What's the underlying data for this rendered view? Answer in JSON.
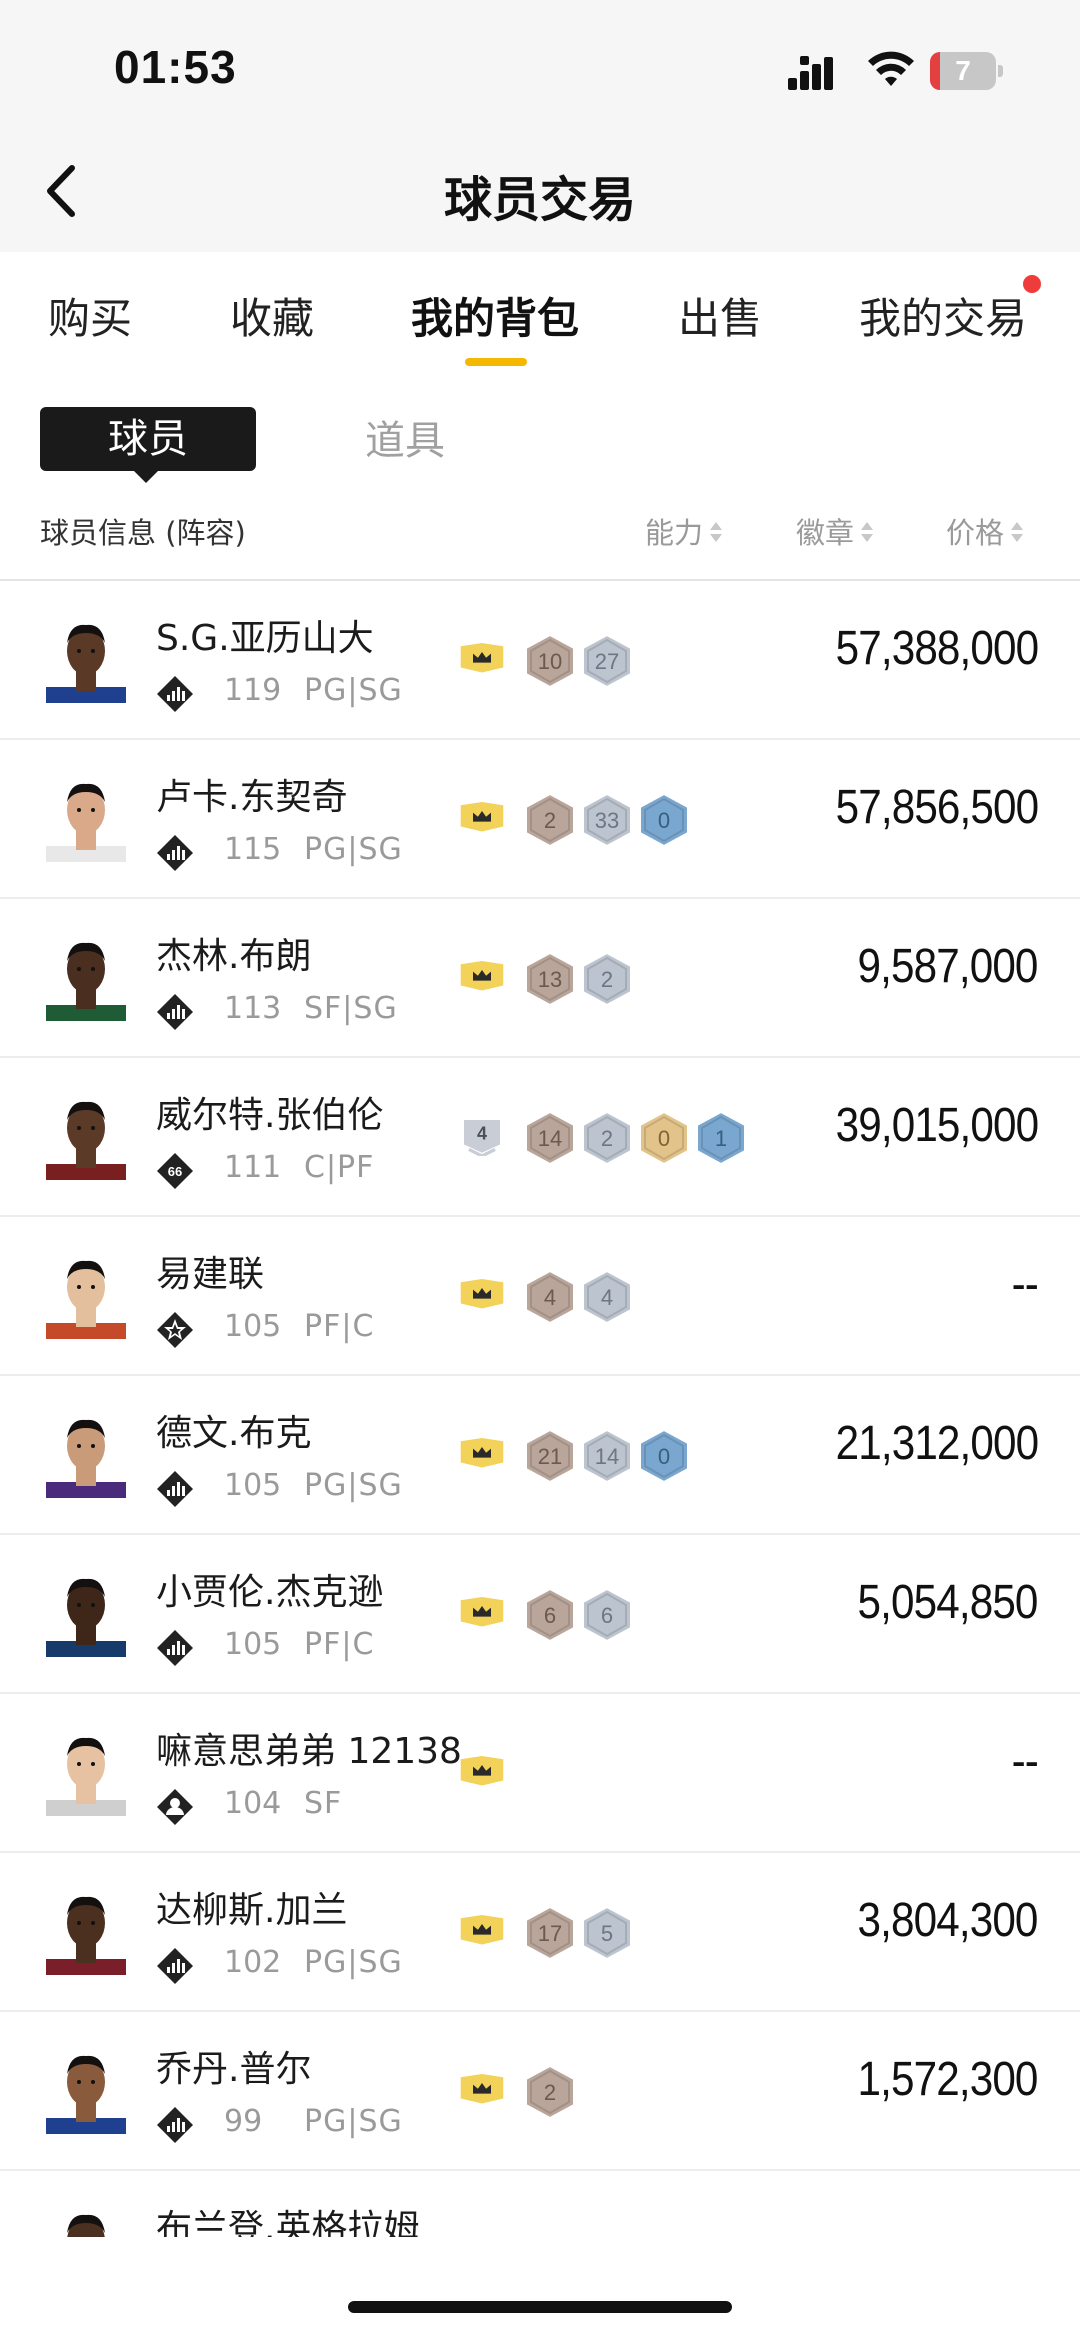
{
  "status": {
    "time": "01:53",
    "battery": "7"
  },
  "header": {
    "title": "球员交易"
  },
  "tabs": [
    {
      "label": "购买",
      "active": false
    },
    {
      "label": "收藏",
      "active": false
    },
    {
      "label": "我的背包",
      "active": true
    },
    {
      "label": "出售",
      "active": false
    },
    {
      "label": "我的交易",
      "active": false,
      "dot": true
    }
  ],
  "segment": {
    "active": "球员",
    "inactive": "道具"
  },
  "columns": {
    "info": "球员信息 (阵容)",
    "ability": "能力",
    "badge": "徽章",
    "price": "价格"
  },
  "colors": {
    "accent": "#f5b800",
    "crown": "#f3d25a",
    "bronze": "#b9a59a",
    "silver": "#bcc4cf",
    "gold": "#e2c389",
    "blue": "#7aa7cf"
  },
  "players": [
    {
      "name": "S.G.亚历山大",
      "ovr": "119",
      "pos": "PG|SG",
      "tier": "bars",
      "crown": "gold",
      "badges": [
        {
          "t": "bronze",
          "v": "10"
        },
        {
          "t": "silver",
          "v": "27"
        }
      ],
      "price": "57,388,000",
      "skin": "#5a3a26"
    },
    {
      "name": "卢卡.东契奇",
      "ovr": "115",
      "pos": "PG|SG",
      "tier": "bars",
      "crown": "gold",
      "badges": [
        {
          "t": "bronze",
          "v": "2"
        },
        {
          "t": "silver",
          "v": "33"
        },
        {
          "t": "blue",
          "v": "0"
        }
      ],
      "price": "57,856,500",
      "skin": "#d9a98a"
    },
    {
      "name": "杰林.布朗",
      "ovr": "113",
      "pos": "SF|SG",
      "tier": "bars",
      "crown": "gold",
      "badges": [
        {
          "t": "bronze",
          "v": "13"
        },
        {
          "t": "silver",
          "v": "2"
        }
      ],
      "price": "9,587,000",
      "skin": "#4a2e1f"
    },
    {
      "name": "威尔特.张伯伦",
      "ovr": "111",
      "pos": "C|PF",
      "tier": "66",
      "crown": "silver4",
      "badges": [
        {
          "t": "bronze",
          "v": "14"
        },
        {
          "t": "silver",
          "v": "2"
        },
        {
          "t": "gold",
          "v": "0"
        },
        {
          "t": "blue",
          "v": "1"
        }
      ],
      "price": "39,015,000",
      "skin": "#5c3a28"
    },
    {
      "name": "易建联",
      "ovr": "105",
      "pos": "PF|C",
      "tier": "star",
      "crown": "gold",
      "badges": [
        {
          "t": "bronze",
          "v": "4"
        },
        {
          "t": "silver",
          "v": "4"
        }
      ],
      "price": "--",
      "skin": "#e4bf9d"
    },
    {
      "name": "德文.布克",
      "ovr": "105",
      "pos": "PG|SG",
      "tier": "bars",
      "crown": "gold",
      "badges": [
        {
          "t": "bronze",
          "v": "21"
        },
        {
          "t": "silver",
          "v": "14"
        },
        {
          "t": "blue",
          "v": "0"
        }
      ],
      "price": "21,312,000",
      "skin": "#c99b78"
    },
    {
      "name": "小贾伦.杰克逊",
      "ovr": "105",
      "pos": "PF|C",
      "tier": "bars",
      "crown": "gold",
      "badges": [
        {
          "t": "bronze",
          "v": "6"
        },
        {
          "t": "silver",
          "v": "6"
        }
      ],
      "price": "5,054,850",
      "skin": "#3e2719"
    },
    {
      "name": "嘛意思弟弟 12138",
      "ovr": "104",
      "pos": "SF",
      "tier": "person",
      "crown": "gold",
      "badges": [],
      "price": "--",
      "skin": "#e6c2a3"
    },
    {
      "name": "达柳斯.加兰",
      "ovr": "102",
      "pos": "PG|SG",
      "tier": "bars",
      "crown": "gold",
      "badges": [
        {
          "t": "bronze",
          "v": "17"
        },
        {
          "t": "silver",
          "v": "5"
        }
      ],
      "price": "3,804,300",
      "skin": "#4b2f1f"
    },
    {
      "name": "乔丹.普尔",
      "ovr": "99",
      "pos": "PG|SG",
      "tier": "bars",
      "crown": "gold",
      "badges": [
        {
          "t": "bronze",
          "v": "2"
        }
      ],
      "price": "1,572,300",
      "skin": "#8a5a3c"
    },
    {
      "name": "布兰登.英格拉姆",
      "ovr": "",
      "pos": "",
      "tier": "",
      "crown": "",
      "badges": [],
      "price": "",
      "skin": "#4b2f1f"
    }
  ]
}
